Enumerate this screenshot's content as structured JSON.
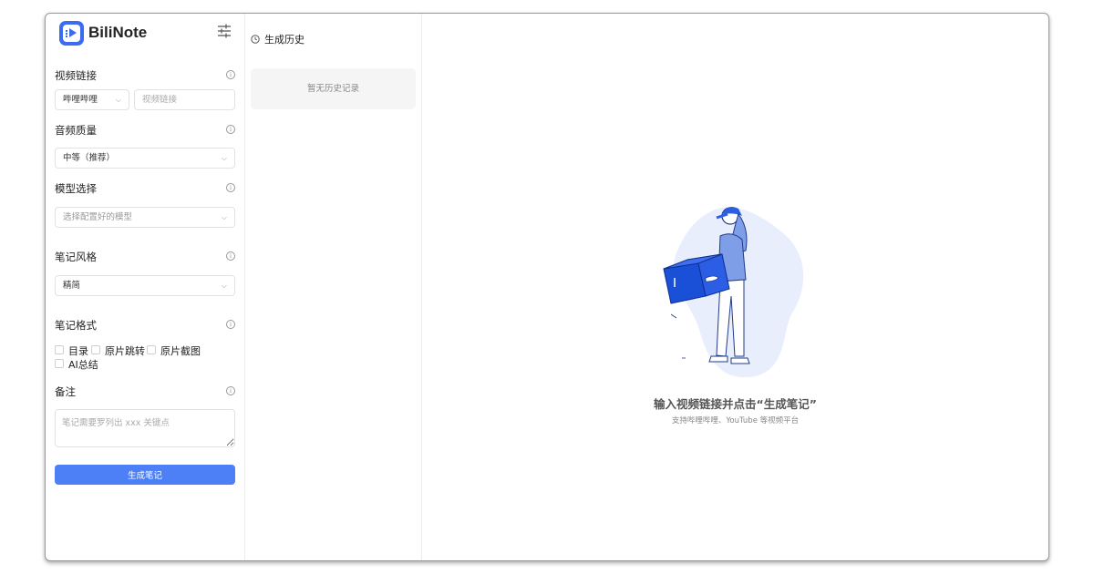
{
  "app": {
    "title": "BiliNote"
  },
  "sidebar": {
    "video_link": {
      "label": "视频链接",
      "platform_selected": "哔哩哔哩",
      "link_placeholder": "视频链接"
    },
    "audio_quality": {
      "label": "音频质量",
      "selected": "中等（推荐）"
    },
    "model": {
      "label": "模型选择",
      "placeholder": "选择配置好的模型"
    },
    "note_style": {
      "label": "笔记风格",
      "selected": "精简"
    },
    "note_format": {
      "label": "笔记格式",
      "options": [
        {
          "label": "目录",
          "checked": false
        },
        {
          "label": "原片跳转",
          "checked": false
        },
        {
          "label": "原片截图",
          "checked": false
        },
        {
          "label": "AI总结",
          "checked": false
        }
      ]
    },
    "remark": {
      "label": "备注",
      "placeholder": "笔记需要罗列出 xxx 关键点"
    },
    "generate_button": "生成笔记"
  },
  "history": {
    "title": "生成历史",
    "empty_text": "暂无历史记录"
  },
  "main": {
    "empty_title": "输入视频链接并点击“生成笔记”",
    "empty_subtitle": "支持哔哩哔哩、YouTube 等视频平台"
  },
  "colors": {
    "primary": "#4d7ff7",
    "logo": "#3b6cf0",
    "illustration_blue": "#1a4fd8",
    "illustration_bg": "#e8eefc"
  },
  "icons": [
    "app-logo-icon",
    "settings-sliders-icon",
    "info-icon",
    "chevron-down-icon",
    "clock-icon"
  ]
}
